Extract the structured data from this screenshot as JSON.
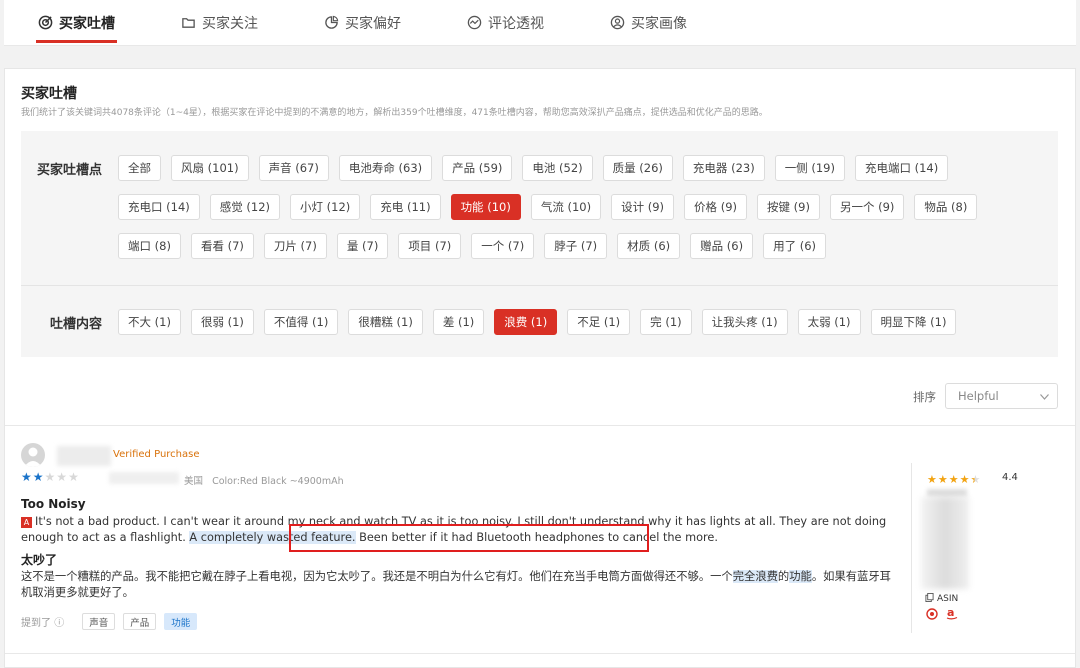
{
  "tabs": [
    {
      "label": "买家吐槽",
      "icon": "target-icon",
      "active": true
    },
    {
      "label": "买家关注",
      "icon": "folder-icon",
      "active": false
    },
    {
      "label": "买家偏好",
      "icon": "pie-icon",
      "active": false
    },
    {
      "label": "评论透视",
      "icon": "wave-icon",
      "active": false
    },
    {
      "label": "买家画像",
      "icon": "user-icon",
      "active": false
    }
  ],
  "section": {
    "title": "买家吐槽",
    "description": "我们统计了该关键词共4078条评论（1~4星），根据买家在评论中提到的不满意的地方，解析出359个吐槽维度，471条吐槽内容，帮助您高效深扒产品痛点，提供选品和优化产品的思路。"
  },
  "filters": {
    "points_label": "买家吐槽点",
    "points": [
      {
        "label": "全部",
        "active": false
      },
      {
        "label": "风扇 (101)",
        "active": false
      },
      {
        "label": "声音 (67)",
        "active": false
      },
      {
        "label": "电池寿命 (63)",
        "active": false
      },
      {
        "label": "产品 (59)",
        "active": false
      },
      {
        "label": "电池 (52)",
        "active": false
      },
      {
        "label": "质量 (26)",
        "active": false
      },
      {
        "label": "充电器 (23)",
        "active": false
      },
      {
        "label": "一侧 (19)",
        "active": false
      },
      {
        "label": "充电端口 (14)",
        "active": false
      },
      {
        "label": "充电口 (14)",
        "active": false
      },
      {
        "label": "感觉 (12)",
        "active": false
      },
      {
        "label": "小灯 (12)",
        "active": false
      },
      {
        "label": "充电 (11)",
        "active": false
      },
      {
        "label": "功能 (10)",
        "active": true
      },
      {
        "label": "气流 (10)",
        "active": false
      },
      {
        "label": "设计 (9)",
        "active": false
      },
      {
        "label": "价格 (9)",
        "active": false
      },
      {
        "label": "按键 (9)",
        "active": false
      },
      {
        "label": "另一个 (9)",
        "active": false
      },
      {
        "label": "物品 (8)",
        "active": false
      },
      {
        "label": "端口 (8)",
        "active": false
      },
      {
        "label": "看看 (7)",
        "active": false
      },
      {
        "label": "刀片 (7)",
        "active": false
      },
      {
        "label": "量 (7)",
        "active": false
      },
      {
        "label": "项目 (7)",
        "active": false
      },
      {
        "label": "一个 (7)",
        "active": false
      },
      {
        "label": "脖子 (7)",
        "active": false
      },
      {
        "label": "材质 (6)",
        "active": false
      },
      {
        "label": "赠品 (6)",
        "active": false
      },
      {
        "label": "用了 (6)",
        "active": false
      }
    ],
    "content_label": "吐槽内容",
    "contents": [
      {
        "label": "不大 (1)",
        "active": false
      },
      {
        "label": "很弱 (1)",
        "active": false
      },
      {
        "label": "不值得 (1)",
        "active": false
      },
      {
        "label": "很糟糕 (1)",
        "active": false
      },
      {
        "label": "差 (1)",
        "active": false
      },
      {
        "label": "浪费 (1)",
        "active": true
      },
      {
        "label": "不足 (1)",
        "active": false
      },
      {
        "label": "完 (1)",
        "active": false
      },
      {
        "label": "让我头疼 (1)",
        "active": false
      },
      {
        "label": "太弱 (1)",
        "active": false
      },
      {
        "label": "明显下降 (1)",
        "active": false
      }
    ]
  },
  "sort": {
    "label": "排序",
    "value": "Helpful"
  },
  "review": {
    "verified": "Verified Purchase",
    "rating": 2,
    "max_rating": 5,
    "country": "美国",
    "variant": "Color:Red Black ~4900mAh",
    "title": "Too Noisy",
    "body_part1": "It's not a bad product. I can't wear it around my neck and watch TV as it is too noisy. I still don't understand why it has lights at all. They are not doing enough to act as a flashlight.",
    "body_highlight": "A completely wasted feature.",
    "body_part3": "Been better if it had Bluetooth headphones to cancel the more.",
    "title_cn": "太吵了",
    "body_cn_part1": "这不是一个糟糕的产品。我不能把它戴在脖子上看电视，因为它太吵了。我还是不明白为什么它有灯。他们在充当手电筒方面做得还不够。一个",
    "body_cn_hl1": "完全浪费",
    "body_cn_part2": "的",
    "body_cn_hl2": "功能",
    "body_cn_part3": "。如果有蓝牙耳机取消更多就更好了。",
    "mentioned_label": "提到了",
    "mentioned_tags": [
      {
        "label": "声音",
        "active": false
      },
      {
        "label": "产品",
        "active": false
      },
      {
        "label": "功能",
        "active": true
      }
    ]
  },
  "product": {
    "rating_text": "4.4",
    "rating": 4.4,
    "asin_label": "ASIN"
  },
  "colors": {
    "accent": "#d93025",
    "link_blue": "#1a73c9",
    "star_gold": "#f2a311",
    "verified": "#d9720b"
  }
}
